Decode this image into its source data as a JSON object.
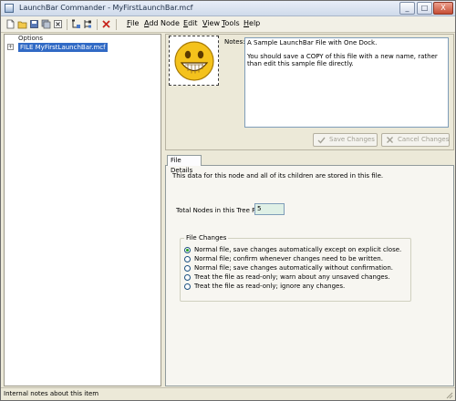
{
  "window": {
    "title": "LaunchBar Commander - MyFirstLaunchBar.mcf",
    "controls": {
      "minimize": "_",
      "maximize": "□",
      "close": "X"
    }
  },
  "toolbar": {
    "icons": [
      "new-file-icon",
      "open-folder-icon",
      "save-icon",
      "save-all-icon",
      "close-file-icon",
      "add-child-icon",
      "add-sibling-icon",
      "delete-icon"
    ],
    "menus": [
      {
        "key": "F",
        "rest": "ile"
      },
      {
        "key": "A",
        "rest": "dd Node"
      },
      {
        "key": "E",
        "rest": "dit"
      },
      {
        "key": "V",
        "rest": "iew"
      },
      {
        "key": "T",
        "rest": "ools"
      },
      {
        "key": "H",
        "rest": "elp"
      }
    ]
  },
  "tree": {
    "column_header": "Options",
    "expander": "+",
    "selected_node": "FILE MyFirstLaunchBar.mcf"
  },
  "notes": {
    "label": "Notes:",
    "line1": "A Sample LaunchBar File with One Dock.",
    "line2": "You should save a COPY of this file with a new name, rather than edit this sample file directly."
  },
  "buttons": {
    "save": "Save Changes",
    "cancel": "Cancel Changes"
  },
  "details": {
    "tab": "File Details",
    "info": "This data for this node and all of its children are stored in this file.",
    "total_nodes_label": "Total Nodes in this Tree File:",
    "total_nodes_value": "5",
    "file_changes": {
      "legend": "File Changes",
      "options": [
        "Normal file, save changes automatically except on explicit close.",
        "Normal file; confirm whenever changes need to be written.",
        "Normal file; save changes automatically without confirmation.",
        "Treat the file as read-only; warn about any unsaved changes.",
        "Treat the file as read-only; ignore any changes."
      ],
      "selected_index": 0
    }
  },
  "status": {
    "text": "Internal notes about this item"
  },
  "colors": {
    "selection": "#316ac5",
    "total_nodes_bg": "#dff0e6",
    "radio_dot": "#21a121"
  }
}
